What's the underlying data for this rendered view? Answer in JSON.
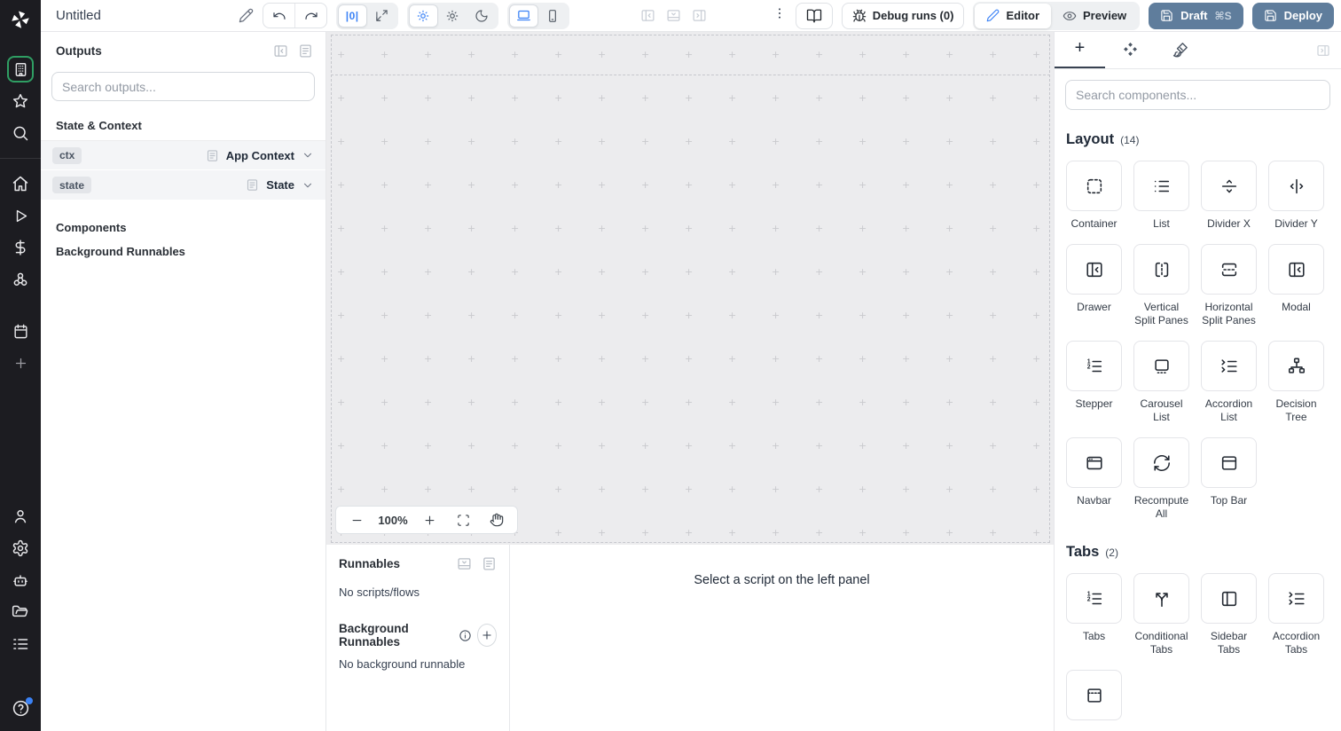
{
  "topbar": {
    "title": "Untitled",
    "zero_badge": "|0|",
    "debug_runs": "Debug runs (0)",
    "editor": "Editor",
    "preview": "Preview",
    "draft": "Draft",
    "draft_shortcut": "⌘S",
    "deploy": "Deploy",
    "icons": [
      "edit-pencil-icon",
      "undo-icon",
      "redo-icon",
      "zero-width-icon",
      "maximize-icon",
      "theme-auto-icon",
      "theme-light-icon",
      "theme-dark-icon",
      "device-desktop-icon",
      "device-mobile-icon",
      "collapse-left-panel-icon",
      "collapse-bottom-panel-icon",
      "collapse-right-panel-icon",
      "kebab-menu-icon",
      "docs-book-icon",
      "bug-icon",
      "eye-icon",
      "save-icon"
    ]
  },
  "rail": {
    "icons": [
      "windmill-logo",
      "apps-icon",
      "favorites-star-icon",
      "search-icon",
      "home-icon",
      "runs-play-icon",
      "variables-dollar-icon",
      "resources-hub-icon",
      "schedules-calendar-icon",
      "create-plus-icon",
      "user-icon",
      "settings-gear-icon",
      "workers-bot-icon",
      "folders-icon",
      "logs-list-icon",
      "help-icon"
    ]
  },
  "outputs": {
    "title": "Outputs",
    "search_placeholder": "Search outputs...",
    "state_context_header": "State & Context",
    "rows": [
      {
        "badge": "ctx",
        "type": "App Context"
      },
      {
        "badge": "state",
        "type": "State"
      }
    ],
    "components_header": "Components",
    "background_header": "Background Runnables"
  },
  "canvas": {
    "zoom": "100%"
  },
  "runnables": {
    "title": "Runnables",
    "empty": "No scripts/flows",
    "background_title": "Background Runnables",
    "background_empty": "No background runnable",
    "select_hint": "Select a script on the left panel"
  },
  "components": {
    "search_placeholder": "Search components...",
    "sections": [
      {
        "title": "Layout",
        "count": "(14)",
        "items": [
          {
            "label": "Container",
            "icon": "container-icon"
          },
          {
            "label": "List",
            "icon": "list-icon"
          },
          {
            "label": "Divider X",
            "icon": "divider-x-icon"
          },
          {
            "label": "Divider Y",
            "icon": "divider-y-icon"
          },
          {
            "label": "Drawer",
            "icon": "drawer-icon"
          },
          {
            "label": "Vertical Split Panes",
            "icon": "vertical-split-icon"
          },
          {
            "label": "Horizontal Split Panes",
            "icon": "horizontal-split-icon"
          },
          {
            "label": "Modal",
            "icon": "modal-icon"
          },
          {
            "label": "Stepper",
            "icon": "stepper-icon"
          },
          {
            "label": "Carousel List",
            "icon": "carousel-icon"
          },
          {
            "label": "Accordion List",
            "icon": "accordion-list-icon"
          },
          {
            "label": "Decision Tree",
            "icon": "decision-tree-icon"
          },
          {
            "label": "Navbar",
            "icon": "navbar-icon"
          },
          {
            "label": "Recompute All",
            "icon": "recompute-icon"
          },
          {
            "label": "Top Bar",
            "icon": "top-bar-icon"
          }
        ]
      },
      {
        "title": "Tabs",
        "count": "(2)",
        "items": [
          {
            "label": "Tabs",
            "icon": "tabs-icon"
          },
          {
            "label": "Conditional Tabs",
            "icon": "conditional-tabs-icon"
          },
          {
            "label": "Sidebar Tabs",
            "icon": "sidebar-tabs-icon"
          },
          {
            "label": "Accordion Tabs",
            "icon": "accordion-tabs-icon"
          },
          {
            "label": "",
            "icon": "dashed-top-panel-icon"
          }
        ]
      }
    ]
  },
  "colors": {
    "accent_blue": "#3b82f6",
    "active_green": "#2f9e63",
    "deploy_button": "#5f7d9c",
    "canvas_bg": "#ececee",
    "rail_bg": "#1c1c21"
  }
}
